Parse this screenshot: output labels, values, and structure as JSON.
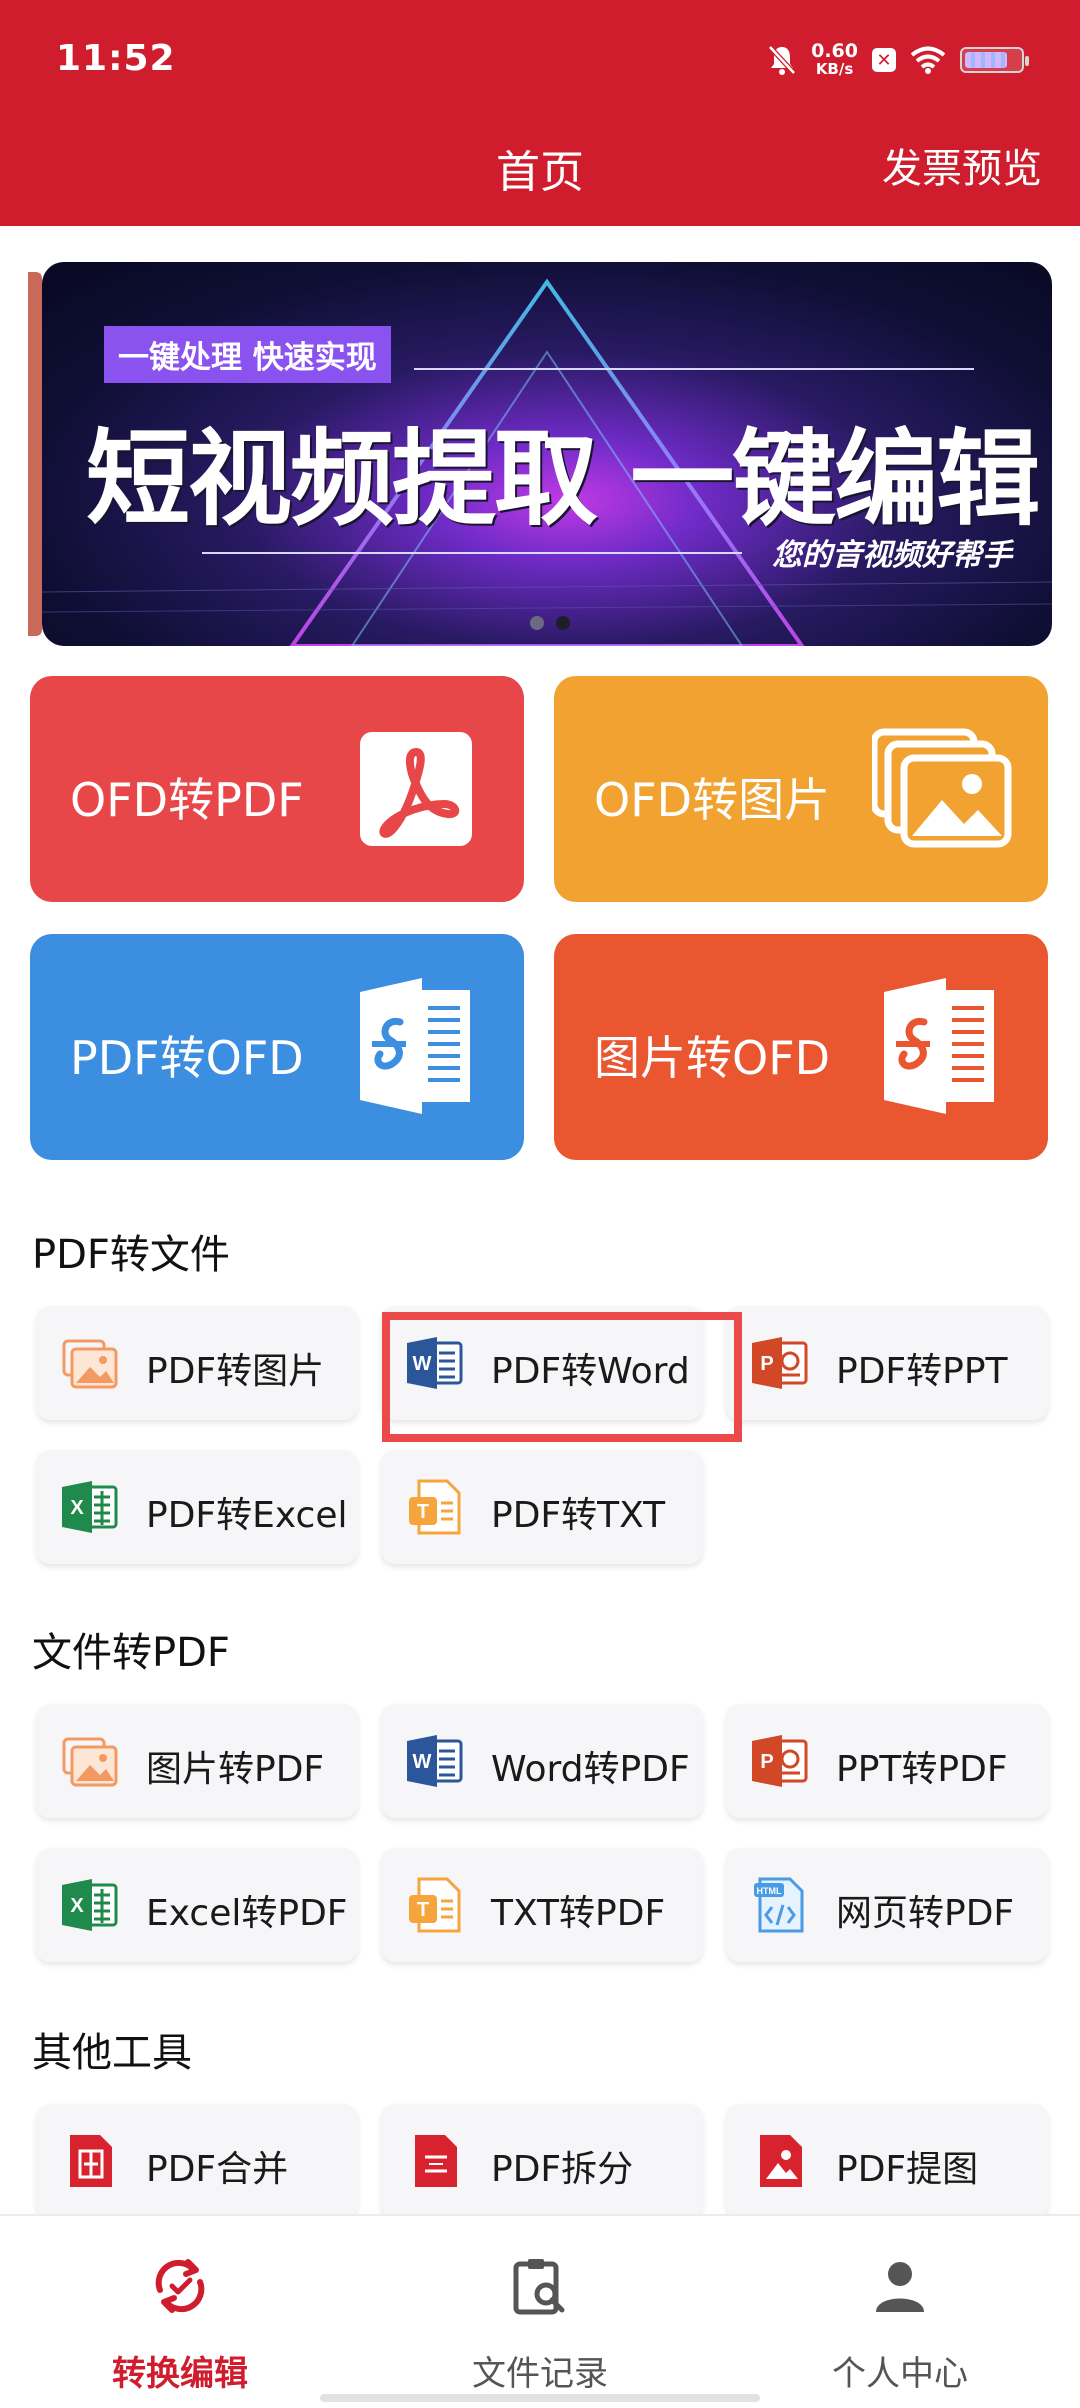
{
  "status_bar": {
    "time": "11:52",
    "net_speed": "0.60",
    "net_unit": "KB/s",
    "icons": [
      "mute-bell-icon",
      "x-app-icon",
      "wifi-icon",
      "battery-icon"
    ]
  },
  "header": {
    "title": "首页",
    "right_action": "发票预览",
    "color": "#cf1d2d"
  },
  "banner": {
    "tag": "一键处理 快速实现",
    "headline": "短视频提取 一键编辑",
    "subtitle": "您的音视频好帮手",
    "page_count": 2,
    "active_page": 2
  },
  "big_cards": [
    {
      "label": "OFD转PDF",
      "color": "#e8474a",
      "icon": "pdf-acrobat-icon"
    },
    {
      "label": "OFD转图片",
      "color": "#f1a230",
      "icon": "images-stack-icon"
    },
    {
      "label": "PDF转OFD",
      "color": "#3c8ee0",
      "icon": "ofd-doc-icon"
    },
    {
      "label": "图片转OFD",
      "color": "#e9562f",
      "icon": "ofd-doc-icon"
    }
  ],
  "sections": {
    "pdf_to_file": {
      "title": "PDF转文件",
      "items": [
        {
          "label": "PDF转图片",
          "icon": "image-file-icon"
        },
        {
          "label": "PDF转Word",
          "icon": "word-icon"
        },
        {
          "label": "PDF转PPT",
          "icon": "ppt-icon"
        },
        {
          "label": "PDF转Excel",
          "icon": "excel-icon"
        },
        {
          "label": "PDF转TXT",
          "icon": "txt-icon"
        }
      ]
    },
    "file_to_pdf": {
      "title": "文件转PDF",
      "items": [
        {
          "label": "图片转PDF",
          "icon": "image-file-icon"
        },
        {
          "label": "Word转PDF",
          "icon": "word-icon"
        },
        {
          "label": "PPT转PDF",
          "icon": "ppt-icon"
        },
        {
          "label": "Excel转PDF",
          "icon": "excel-icon"
        },
        {
          "label": "TXT转PDF",
          "icon": "txt-icon"
        },
        {
          "label": "网页转PDF",
          "icon": "html-icon"
        }
      ]
    },
    "other_tools": {
      "title": "其他工具",
      "items": [
        {
          "label": "PDF合并",
          "icon": "pdf-merge-icon"
        },
        {
          "label": "PDF拆分",
          "icon": "pdf-split-icon"
        },
        {
          "label": "PDF提图",
          "icon": "pdf-extract-image-icon"
        }
      ]
    }
  },
  "bottom_nav": [
    {
      "label": "转换编辑",
      "icon": "convert-edit-icon",
      "active": true
    },
    {
      "label": "文件记录",
      "icon": "file-record-icon",
      "active": false
    },
    {
      "label": "个人中心",
      "icon": "person-icon",
      "active": false
    }
  ]
}
